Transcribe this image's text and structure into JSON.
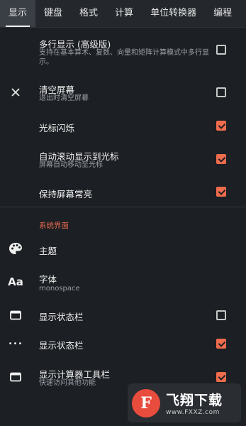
{
  "tabs": [
    {
      "label": "显示",
      "active": true
    },
    {
      "label": "键盘",
      "active": false
    },
    {
      "label": "格式",
      "active": false
    },
    {
      "label": "计算",
      "active": false
    },
    {
      "label": "单位转换器",
      "active": false
    },
    {
      "label": "编程",
      "active": false
    }
  ],
  "settings": {
    "multiline": {
      "title": "多行显示 (高级版)",
      "subtitle": "支持在基本算术、复数、向量和矩阵计算模式中多行显示。",
      "checked": false
    },
    "clear_screen": {
      "title": "清空屏幕",
      "subtitle": "退出时清空屏幕",
      "checked": false,
      "icon": "close-icon"
    },
    "cursor_blink": {
      "title": "光标闪烁",
      "checked": true
    },
    "auto_scroll": {
      "title": "自动滚动显示到光标",
      "subtitle": "屏幕自动移动至光标",
      "checked": true
    },
    "keep_screen_on": {
      "title": "保持屏幕常亮",
      "checked": true
    }
  },
  "system_ui": {
    "section_title": "系统界面",
    "theme": {
      "title": "主题",
      "icon": "palette-icon"
    },
    "font": {
      "title": "字体",
      "value": "monospace",
      "icon": "font-icon",
      "icon_glyph": "Aa"
    },
    "status_bar": {
      "title": "显示状态栏",
      "checked": false,
      "icon": "window-icon"
    },
    "status_bar_2": {
      "title": "显示状态栏",
      "checked": true,
      "icon": "more-icon",
      "icon_glyph": "•••"
    },
    "toolbar": {
      "title": "显示计算器工具栏",
      "subtitle": "快速访问其他功能",
      "checked": true,
      "icon": "window-icon"
    }
  },
  "watermark": {
    "logo_glyph": "F",
    "name": "飞翔下载",
    "url": "www.FXXZ.com"
  },
  "colors": {
    "accent": "#ee6c4d",
    "section": "#e56a4e",
    "background": "#1c1f23",
    "tabbar": "#24282d"
  }
}
